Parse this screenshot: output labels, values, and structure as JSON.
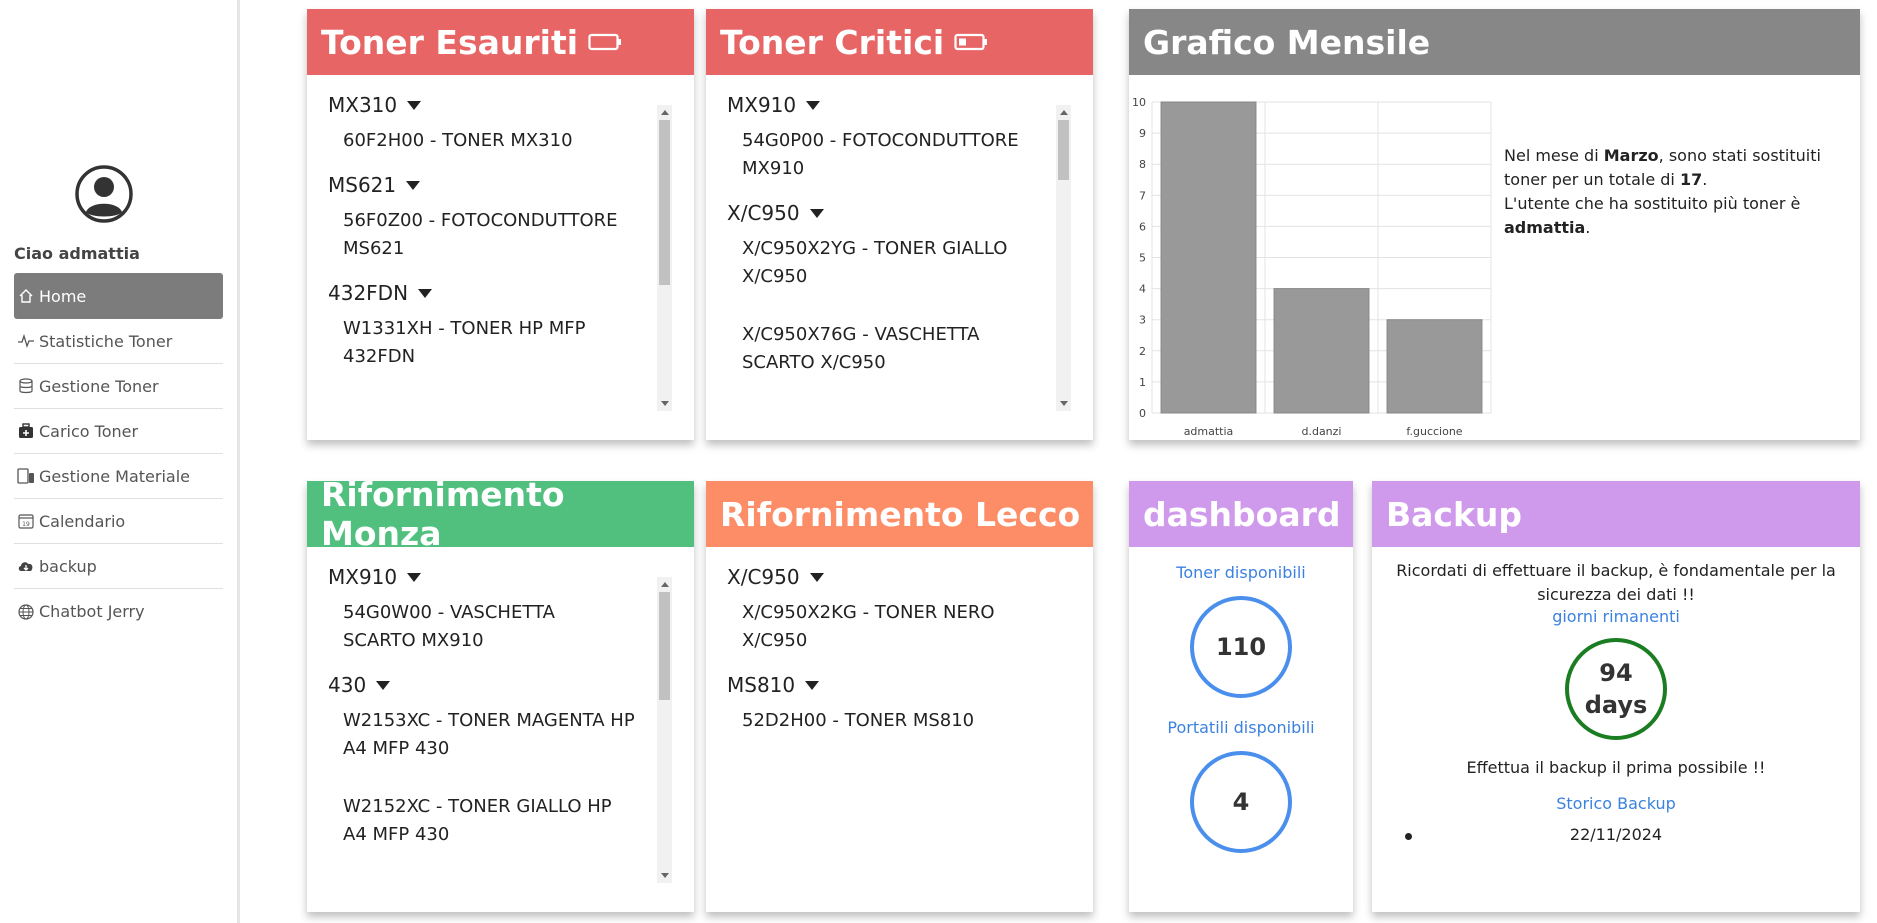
{
  "sidebar": {
    "greeting": "Ciao admattia",
    "items": [
      {
        "label": "Home",
        "icon": "home-icon"
      },
      {
        "label": "Statistiche Toner",
        "icon": "activity-icon"
      },
      {
        "label": "Gestione Toner",
        "icon": "database-icon"
      },
      {
        "label": "Carico Toner",
        "icon": "briefcase-plus-icon"
      },
      {
        "label": "Gestione Materiale",
        "icon": "devices-icon"
      },
      {
        "label": "Calendario",
        "icon": "calendar-icon"
      },
      {
        "label": "backup",
        "icon": "cloud-download-icon"
      },
      {
        "label": "Chatbot Jerry",
        "icon": "globe-icon"
      }
    ]
  },
  "colors": {
    "red_header": "#e86565",
    "gray_header": "#878787",
    "green_header": "#51c07f",
    "orange_header": "#fd8d67",
    "purple_header": "#cf99ec",
    "blue_ring": "#4a8fec",
    "green_ring": "#1a7d22"
  },
  "toner_esauriti": {
    "title": "Toner Esauriti",
    "groups": [
      {
        "model": "MX310",
        "items": [
          "60F2H00 - TONER MX310"
        ]
      },
      {
        "model": "MS621",
        "items": [
          "56F0Z00 - FOTOCONDUTTORE MS621"
        ]
      },
      {
        "model": "432FDN",
        "items": [
          "W1331XH - TONER HP MFP 432FDN"
        ]
      }
    ]
  },
  "toner_critici": {
    "title": "Toner Critici",
    "groups": [
      {
        "model": "MX910",
        "items": [
          "54G0P00 - FOTOCONDUTTORE MX910"
        ]
      },
      {
        "model": "X/C950",
        "items": [
          "X/C950X2YG - TONER GIALLO X/C950",
          "X/C950X76G - VASCHETTA SCARTO X/C950"
        ]
      }
    ]
  },
  "grafico": {
    "title": "Grafico Mensile",
    "text": {
      "p1": "Nel mese di ",
      "month": "Marzo",
      "p2": ", sono stati sostituiti toner per un totale di ",
      "total": "17",
      "p3": ".",
      "p4": "L'utente che ha sostituito più toner è ",
      "top_user": "admattia",
      "p5": "."
    }
  },
  "chart_data": {
    "type": "bar",
    "categories": [
      "admattia",
      "d.danzi",
      "f.guccione"
    ],
    "values": [
      10,
      4,
      3
    ],
    "ylim": [
      0,
      10
    ],
    "yticks": [
      0,
      1,
      2,
      3,
      4,
      5,
      6,
      7,
      8,
      9,
      10
    ],
    "grid": true,
    "bar_color": "#999999"
  },
  "rifornimento_monza": {
    "title": "Rifornimento Monza",
    "groups": [
      {
        "model": "MX910",
        "items": [
          "54G0W00 - VASCHETTA SCARTO MX910"
        ]
      },
      {
        "model": "430",
        "items": [
          "W2153XC - TONER MAGENTA HP A4 MFP 430",
          "W2152XC - TONER GIALLO HP A4 MFP 430"
        ]
      }
    ]
  },
  "rifornimento_lecco": {
    "title": "Rifornimento Lecco",
    "groups": [
      {
        "model": "X/C950",
        "items": [
          "X/C950X2KG - TONER NERO X/C950"
        ]
      },
      {
        "model": "MS810",
        "items": [
          "52D2H00 - TONER MS810"
        ]
      }
    ]
  },
  "dashboard": {
    "title": "dashboard",
    "toner_label": "Toner disponibili",
    "toner_value": "110",
    "portatili_label": "Portatili disponibili",
    "portatili_value": "4"
  },
  "backup": {
    "title": "Backup",
    "reminder": "Ricordati di effettuare il backup, è fondamentale per la sicurezza dei dati !!",
    "days_label": "giorni rimanenti",
    "days_value": "94",
    "days_unit": "days",
    "warning": "Effettua il backup il prima possibile !!",
    "history_label": "Storico Backup",
    "history": [
      "22/11/2024"
    ]
  }
}
